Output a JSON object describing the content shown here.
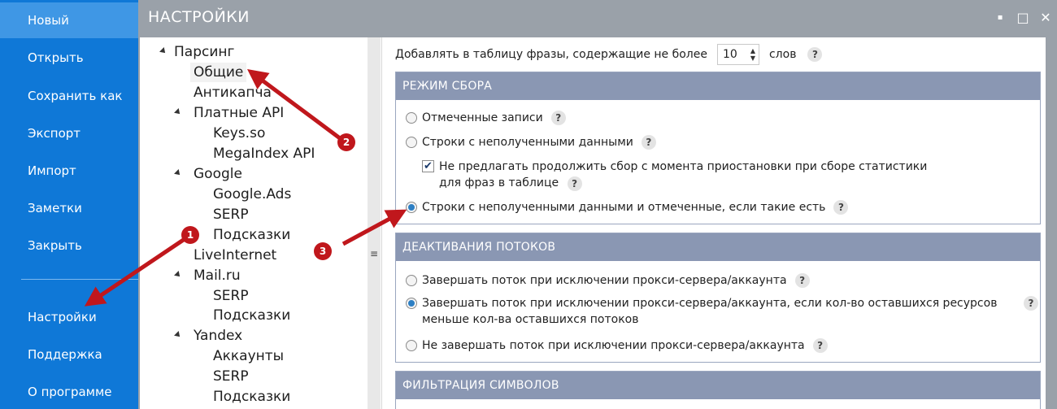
{
  "sidebar": {
    "items": [
      {
        "label": "Новый",
        "active": true
      },
      {
        "label": "Открыть"
      },
      {
        "label": "Сохранить как"
      },
      {
        "label": "Экспорт"
      },
      {
        "label": "Импорт"
      },
      {
        "label": "Заметки"
      },
      {
        "label": "Закрыть"
      },
      {
        "label": "Настройки"
      },
      {
        "label": "Поддержка"
      },
      {
        "label": "О программе"
      }
    ]
  },
  "window": {
    "title": "НАСТРОЙКИ",
    "minimize": "▪",
    "maximize": "□",
    "close": "✕"
  },
  "tree": {
    "items": [
      {
        "label": "Парсинг"
      },
      {
        "label": "Общие",
        "selected": true
      },
      {
        "label": "Антикапча"
      },
      {
        "label": "Платные API"
      },
      {
        "label": "Keys.so"
      },
      {
        "label": "MegaIndex API"
      },
      {
        "label": "Google"
      },
      {
        "label": "Google.Ads"
      },
      {
        "label": "SERP"
      },
      {
        "label": "Подсказки"
      },
      {
        "label": "LiveInternet"
      },
      {
        "label": "Mail.ru"
      },
      {
        "label": "SERP"
      },
      {
        "label": "Подсказки"
      },
      {
        "label": "Yandex"
      },
      {
        "label": "Аккаунты"
      },
      {
        "label": "SERP"
      },
      {
        "label": "Подсказки"
      }
    ],
    "splitter_glyph": "≡"
  },
  "settings": {
    "phrase_limit": {
      "prefix": "Добавлять в таблицу фразы, содержащие не более",
      "value": "10",
      "suffix": "слов"
    },
    "help_glyph": "?",
    "collect_mode": {
      "header": "РЕЖИМ СБОРА",
      "options": [
        {
          "label": "Отмеченные записи",
          "checked": false
        },
        {
          "label": "Строки с неполученными данными",
          "checked": false
        },
        {
          "label": "Не предлагать продолжить сбор с момента приостановки при сборе статистики для фраз в таблице",
          "checked": true
        },
        {
          "label": "Строки с неполученными данными и отмеченные, если такие есть",
          "checked": true
        }
      ]
    },
    "thread_deactivation": {
      "header": "ДЕАКТИВАНИЯ ПОТОКОВ",
      "options": [
        {
          "label": "Завершать поток при исключении прокси-сервера/аккаунта",
          "checked": false
        },
        {
          "label": "Завершать поток при исключении прокси-сервера/аккаунта, если кол-во оставшихся ресурсов меньше кол-ва оставшихся потоков",
          "checked": true
        },
        {
          "label": "Не завершать поток при исключении прокси-сервера/аккаунта",
          "checked": false
        }
      ]
    },
    "char_filter": {
      "header": "ФИЛЬТРАЦИЯ СИМВОЛОВ"
    }
  },
  "annotations": {
    "badges": [
      "1",
      "2",
      "3"
    ],
    "color": "#c0171c"
  }
}
